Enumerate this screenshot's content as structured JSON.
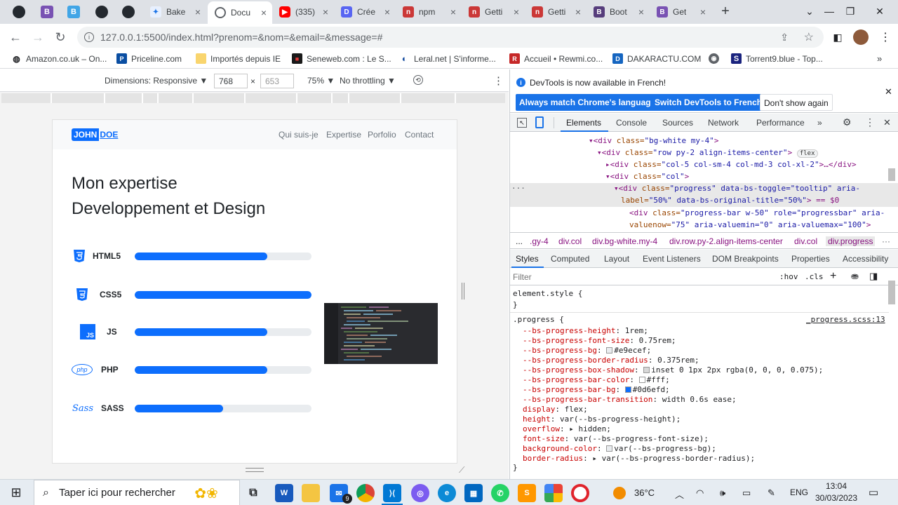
{
  "tabs": [
    {
      "title": "Bake",
      "color": "#e8f0fe"
    },
    {
      "title": "Docu",
      "color": "#5f6368"
    },
    {
      "title": "(335)",
      "color": "#ff0000"
    },
    {
      "title": "Crée",
      "color": "#5865f2"
    },
    {
      "title": "npm",
      "color": "#cb3837"
    },
    {
      "title": "Getti",
      "color": "#cb3837"
    },
    {
      "title": "Getti",
      "color": "#cb3837"
    },
    {
      "title": "Boot",
      "color": "#563d7c"
    },
    {
      "title": "Get",
      "color": "#7952b3"
    }
  ],
  "pinned_tabs": [
    "github",
    "bootstrap",
    "bootstrap-blue",
    "github",
    "github"
  ],
  "address": {
    "url": "127.0.0.1:5500/index.html?prenom=&nom=&email=&message=#"
  },
  "bookmarks": [
    "Amazon.co.uk – On...",
    "Priceline.com",
    "Importés depuis IE",
    "Seneweb.com : Le S...",
    "Leral.net | S'informe...",
    "Accueil • Rewmi.co...",
    "DAKARACTU.COM",
    "",
    "Torrent9.blue - Top..."
  ],
  "device": {
    "dimensions_label": "Dimensions: Responsive",
    "width": "768",
    "height": "653",
    "x": "×",
    "zoom": "75%",
    "throttle": "No throttling"
  },
  "site": {
    "logo_a": "JOHN",
    "logo_b": "DOE",
    "nav": [
      "Qui suis-je",
      "Expertise",
      "Porfolio",
      "Contact"
    ],
    "heading_1": "Mon expertise",
    "heading_2": "Developpement et Design",
    "skills": [
      {
        "name": "HTML5",
        "level": 0.75,
        "icon": "html5-icon"
      },
      {
        "name": "CSS5",
        "level": 1.0,
        "icon": "css3-icon"
      },
      {
        "name": "JS",
        "level": 0.75,
        "icon": "js-icon"
      },
      {
        "name": "PHP",
        "level": 0.75,
        "icon": "php-icon"
      },
      {
        "name": "SASS",
        "level": 0.5,
        "icon": "sass-icon"
      }
    ]
  },
  "devtools": {
    "banner_text": "DevTools is now available in French!",
    "btn_match": "Always match Chrome's language",
    "btn_switch": "Switch DevTools to French",
    "btn_dont": "Don't show again",
    "tabs": [
      "Elements",
      "Console",
      "Sources",
      "Network",
      "Performance"
    ],
    "elements": [
      {
        "tag": "▾<div ",
        "attrs": "class=",
        "val": "\"bg-white my-4\"",
        "end": ">"
      },
      {
        "tag": "▾<div ",
        "attrs": "class=",
        "val": "\"row py-2 align-items-center\"",
        "end": ">"
      },
      {
        "tag": "▸<div ",
        "attrs": "class=",
        "val": "\"col-5 col-sm-4 col-md-3 col-xl-2\"",
        "end": ">…</div>"
      },
      {
        "tag": "▾<div ",
        "attrs": "class=",
        "val": "\"col\"",
        "end": ">"
      },
      {
        "tag": "▾<div ",
        "attrs": "class=",
        "val": "\"progress\" data-bs-toggle=\"tooltip\" aria-",
        "end": ""
      },
      {
        "tag": "",
        "attrs": "label=",
        "val": "\"50%\" data-bs-original-title=\"50%\"",
        "end": "> == $0"
      },
      {
        "tag": "<div ",
        "attrs": "class=",
        "val": "\"progress-bar w-50\" role=\"progressbar\" aria-",
        "end": ""
      },
      {
        "tag": "",
        "attrs": "valuenow=",
        "val": "\"75\" aria-valuemin=\"0\" aria-valuemax=\"100\"",
        "end": ">"
      }
    ],
    "crumbs": [
      "...",
      ".gy-4",
      "div.col",
      "div.bg-white.my-4",
      "div.row.py-2.align-items-center",
      "div.col",
      "div.progress"
    ],
    "style_tabs": [
      "Styles",
      "Computed",
      "Layout",
      "Event Listeners",
      "DOM Breakpoints",
      "Properties",
      "Accessibility"
    ],
    "filter_placeholder": "Filter",
    "hov": ":hov",
    "cls": ".cls",
    "element_style": "element.style {",
    "close_brace": "}",
    "rule_selector": ".progress {",
    "rule_source": "_progress.scss:13",
    "declarations": [
      {
        "p": "--bs-progress-height",
        "v": "1rem;"
      },
      {
        "p": "--bs-progress-font-size",
        "v": "0.75rem;"
      },
      {
        "p": "--bs-progress-bg",
        "v": "#e9ecef;",
        "swatch": "#e9ecef"
      },
      {
        "p": "--bs-progress-border-radius",
        "v": "0.375rem;"
      },
      {
        "p": "--bs-progress-box-shadow",
        "v": "inset 0 1px 2px rgba(0, 0, 0, 0.075);",
        "swatch": "#d8d8d8"
      },
      {
        "p": "--bs-progress-bar-color",
        "v": "#fff;",
        "swatch": "#ffffff"
      },
      {
        "p": "--bs-progress-bar-bg",
        "v": "#0d6efd;",
        "swatch": "#0d6efd"
      },
      {
        "p": "--bs-progress-bar-transition",
        "v": "width 0.6s ease;"
      },
      {
        "p": "display",
        "v": "flex;"
      },
      {
        "p": "height",
        "v": "var(--bs-progress-height);"
      },
      {
        "p": "overflow",
        "v": "▸ hidden;"
      },
      {
        "p": "font-size",
        "v": "var(--bs-progress-font-size);"
      },
      {
        "p": "background-color",
        "v": "var(--bs-progress-bg);",
        "swatch": "#e9ecef"
      },
      {
        "p": "border-radius",
        "v": "▸ var(--bs-progress-border-radius);"
      }
    ]
  },
  "taskbar": {
    "search_placeholder": "Taper ici pour rechercher",
    "temperature": "36°C",
    "lang": "ENG",
    "time": "13:04",
    "date": "30/03/2023",
    "badge": "9"
  }
}
